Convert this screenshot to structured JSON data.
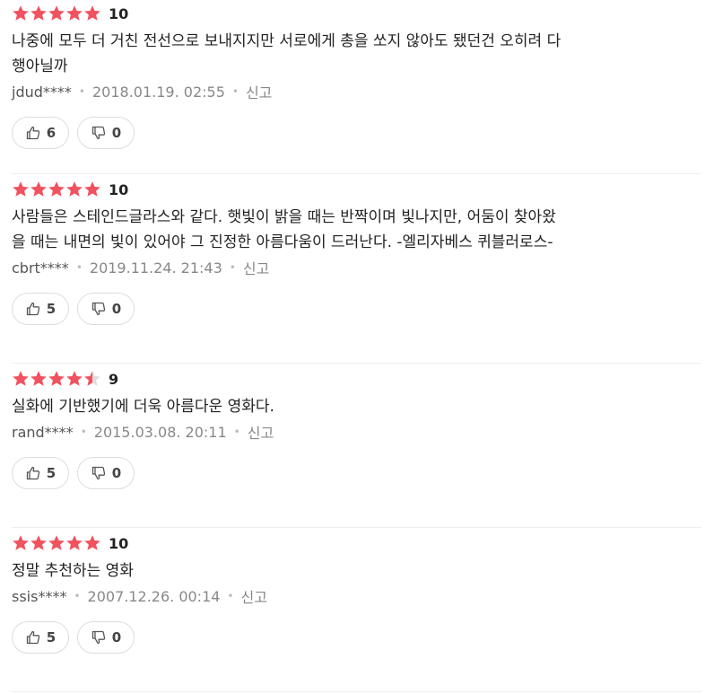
{
  "colors": {
    "star": "#f0525f",
    "star_empty": "#dddddd",
    "text": "#222222",
    "meta": "#888888",
    "border": "#dddddd"
  },
  "reviews": [
    {
      "rating": 5,
      "score": "10",
      "comment_lines": [
        "나중에 모두 더 거친 전선으로 보내지지만 서로에게 총을 쏘지 않아도 됐던건 오히려 다",
        "행아닐까"
      ],
      "user": "jdud****",
      "date": "2018.01.19. 02:55",
      "report": "신고",
      "likes": "6",
      "dislikes": "0"
    },
    {
      "rating": 5,
      "score": "10",
      "comment_lines": [
        "사람들은 스테인드글라스와 같다. 햇빛이 밝을 때는 반짝이며 빛나지만, 어둠이 찾아왔",
        "을 때는 내면의 빛이 있어야 그 진정한 아름다움이 드러난다. -엘리자베스 퀴블러로스-"
      ],
      "user": "cbrt****",
      "date": "2019.11.24. 21:43",
      "report": "신고",
      "likes": "5",
      "dislikes": "0"
    },
    {
      "rating": 4.5,
      "score": "9",
      "comment_lines": [
        "실화에 기반했기에 더욱 아름다운 영화다."
      ],
      "user": "rand****",
      "date": "2015.03.08. 20:11",
      "report": "신고",
      "likes": "5",
      "dislikes": "0"
    },
    {
      "rating": 5,
      "score": "10",
      "comment_lines": [
        "정말 추천하는 영화"
      ],
      "user": "ssis****",
      "date": "2007.12.26. 00:14",
      "report": "신고",
      "likes": "5",
      "dislikes": "0"
    }
  ],
  "icons": {
    "star": "star-icon",
    "like": "thumbs-up-icon",
    "dislike": "thumbs-down-icon"
  }
}
